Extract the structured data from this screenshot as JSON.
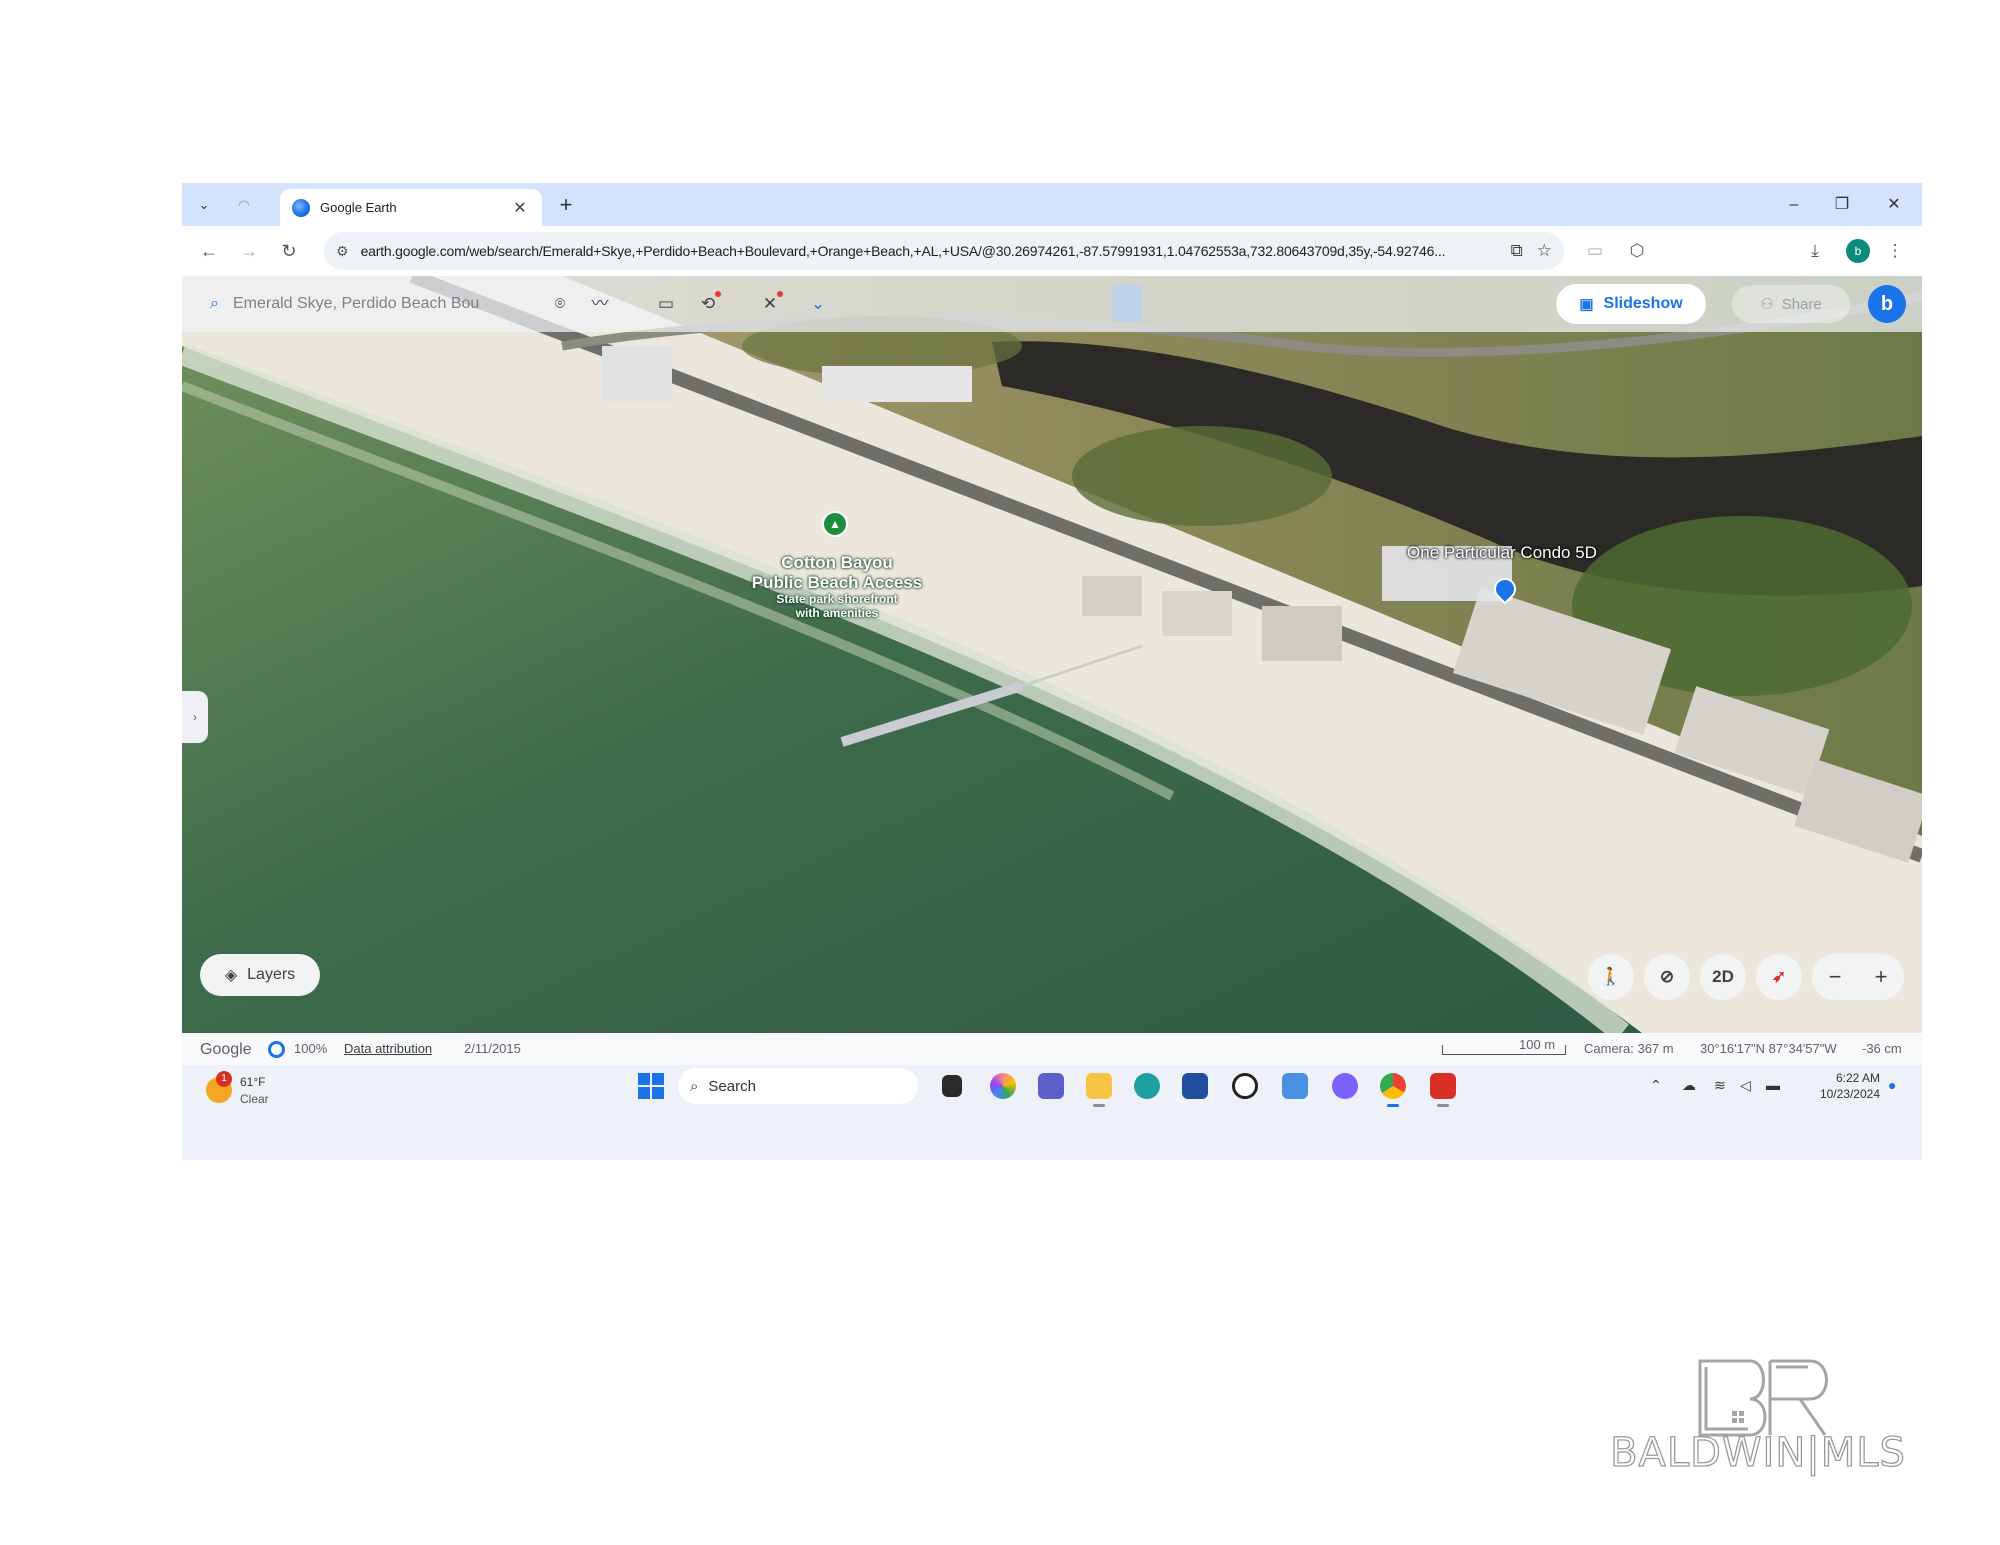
{
  "browser": {
    "tab_title": "Google Earth",
    "url": "earth.google.com/web/search/Emerald+Skye,+Perdido+Beach+Boulevard,+Orange+Beach,+AL,+USA/@30.26974261,-87.57991931,1.04762553a,732.80643709d,35y,-54.92746...",
    "profile_letter": "b"
  },
  "earth": {
    "search_value": "Emerald Skye, Perdido Beach Bou",
    "slideshow_label": "Slideshow",
    "share_label": "Share",
    "avatar_letter": "b",
    "layers_label": "Layers",
    "view_mode_label": "2D",
    "labels": {
      "poi_line1": "Cotton Bayou",
      "poi_line2": "Public Beach Access",
      "poi_line3": "State park shorefront",
      "poi_line4": "with amenities",
      "place": "One Particular Condo 5D"
    }
  },
  "status": {
    "google": "Google",
    "percent": "100%",
    "data_attribution": "Data attribution",
    "date": "2/11/2015",
    "scale": "100 m",
    "camera": "Camera: 367 m",
    "coords": "30°16'17\"N 87°34'57\"W",
    "elevation": "-36 cm"
  },
  "taskbar": {
    "temp": "61°F",
    "condition": "Clear",
    "weather_badge": "1",
    "search_label": "Search",
    "time": "6:22 AM",
    "date": "10/23/2024"
  },
  "watermark": {
    "text": "BALDWIN|MLS"
  },
  "colors": {
    "accent": "#1a73e8",
    "tab_strip": "#d3e3fd",
    "poi_green": "#1e8e3e"
  }
}
